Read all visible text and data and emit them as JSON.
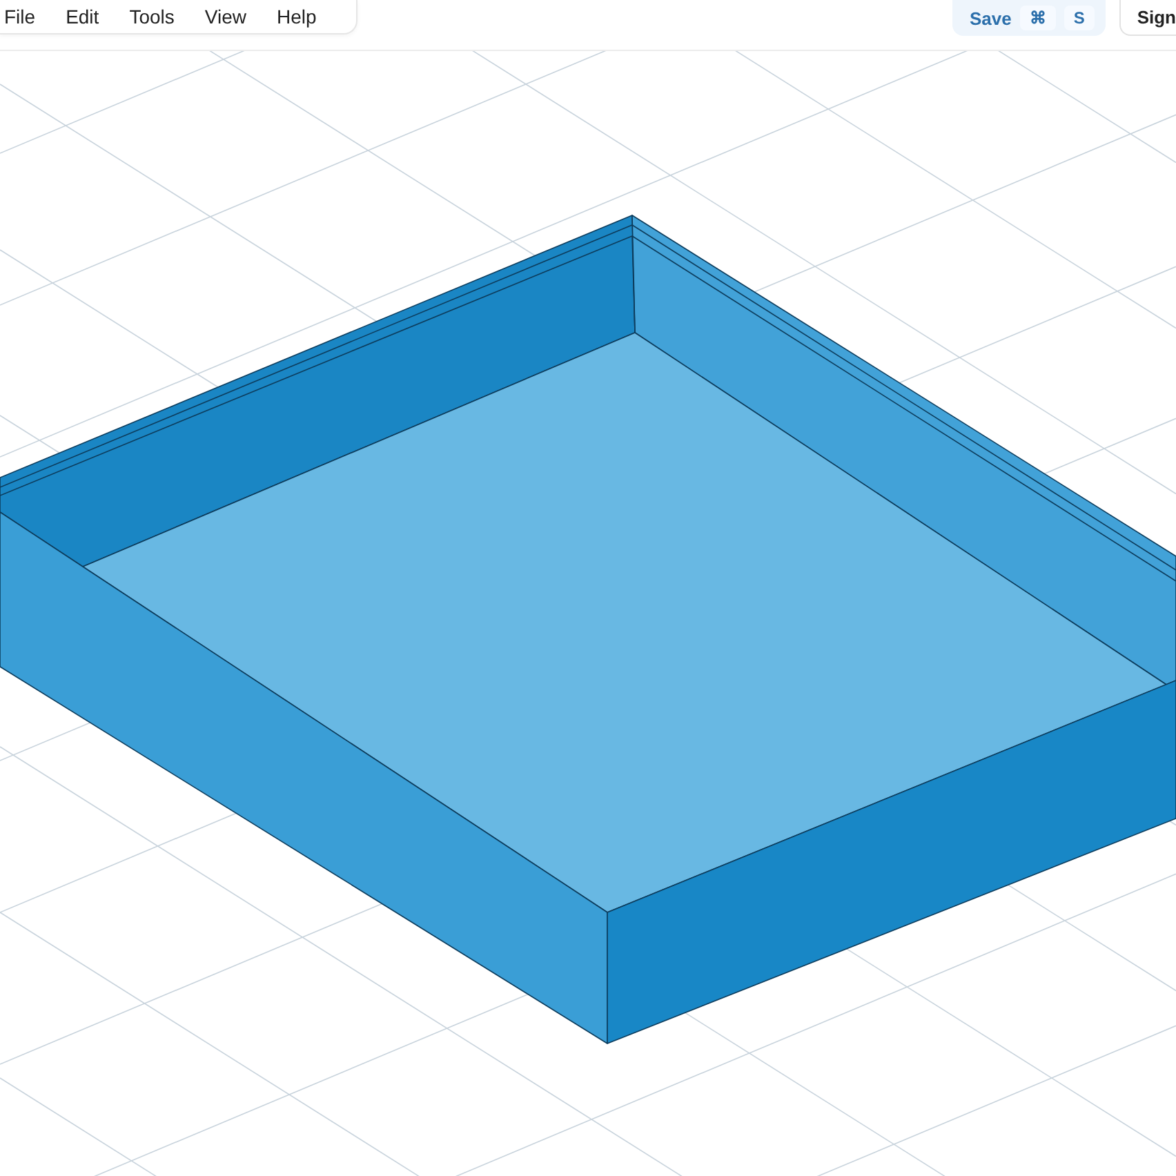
{
  "menu": [
    "File",
    "Edit",
    "Tools",
    "View",
    "Help"
  ],
  "save": {
    "label": "Save",
    "keys": [
      "⌘",
      "S"
    ]
  },
  "account": {
    "label": "Sign"
  }
}
